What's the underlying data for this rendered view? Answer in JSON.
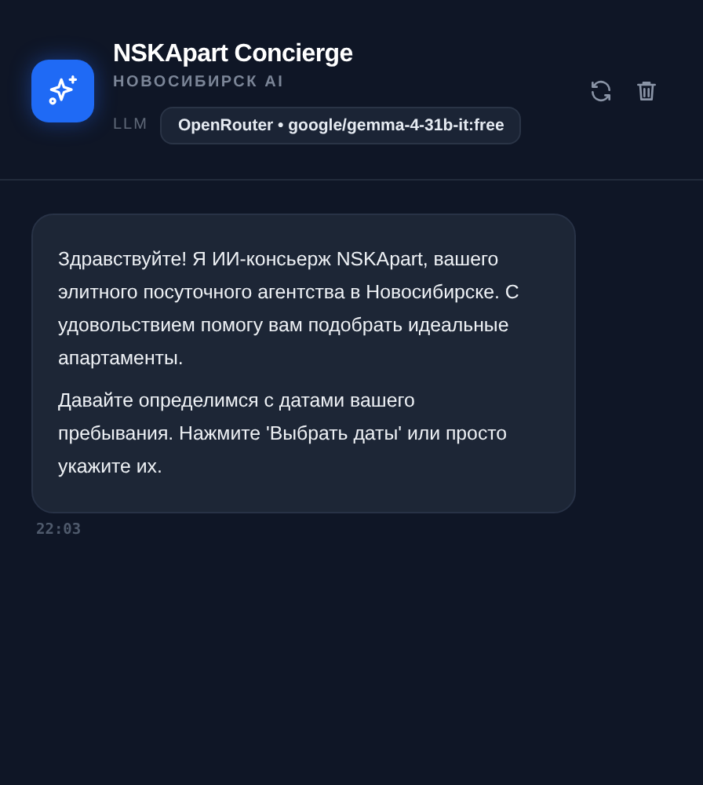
{
  "header": {
    "title": "NSKApart Concierge",
    "subtitle": "НОВОСИБИРСК AI",
    "llm_label": "LLM",
    "model": "OpenRouter • google/gemma-4-31b-it:free"
  },
  "messages": [
    {
      "kind": "incoming",
      "paragraphs": [
        "Здравствуйте! Я ИИ-консьерж NSKApart, вашего элитного посуточного агентства в Новосибирске. С удовольствием помогу вам подобрать идеальные апартаменты.",
        "Давайте определимся с датами вашего пребывания. Нажмите 'Выбрать даты' или просто укажите их."
      ],
      "time": "22:03"
    }
  ]
}
